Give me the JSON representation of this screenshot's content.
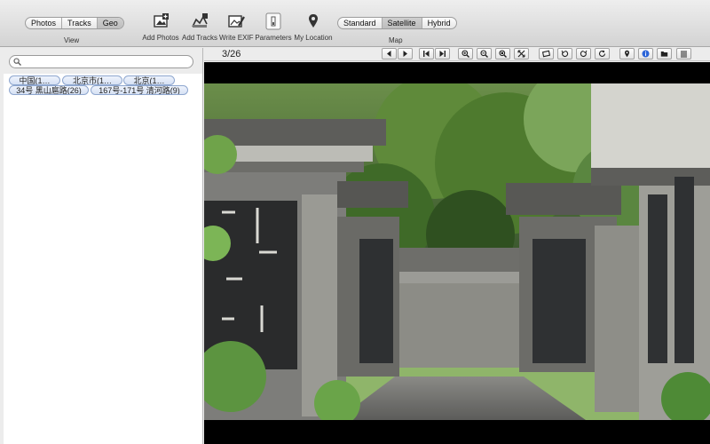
{
  "toolbar": {
    "view_tabs": [
      "Photos",
      "Tracks",
      "Geo"
    ],
    "view_selected": "Geo",
    "view_label": "View",
    "buttons": {
      "add_photos": "Add Photos",
      "add_tracks": "Add Tracks",
      "write_exif": "Write EXIF",
      "parameters": "Parameters",
      "my_location": "My Location"
    },
    "map_tabs": [
      "Standard",
      "Satellite",
      "Hybrid"
    ],
    "map_selected": "Satellite",
    "map_label": "Map"
  },
  "sidebar": {
    "search": {
      "placeholder": ""
    },
    "tags": [
      "中国(1…",
      "北京市(1…",
      "北京(1…",
      "34号 黑山扈路(26)",
      "167号-171号 清河路(9)"
    ]
  },
  "viewer": {
    "counter": "3/26",
    "icons": [
      "prev-icon",
      "next-icon",
      "first-icon",
      "last-icon",
      "zoom-in-icon",
      "zoom-out-icon",
      "zoom-fit-icon",
      "fullscreen-icon",
      "crop-icon",
      "rotate-left-icon",
      "rotate-right-icon",
      "refresh-icon",
      "location-pin-icon",
      "info-icon",
      "folder-icon",
      "list-icon"
    ],
    "photo": "stone-stele-corridor"
  },
  "colors": {
    "accent": "#2b64d8",
    "tag_border": "#8fa7cf",
    "tag_fill": "#dbe5f6"
  }
}
